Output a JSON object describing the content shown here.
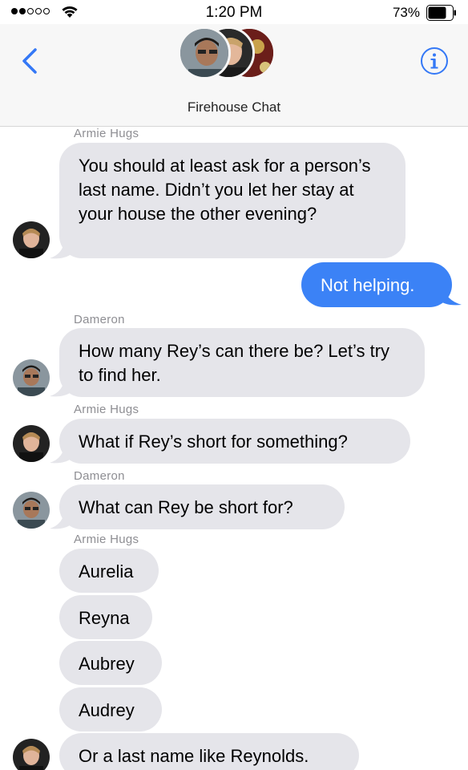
{
  "status_bar": {
    "time": "1:20 PM",
    "battery_percent": "73%"
  },
  "header": {
    "title": "Firehouse Chat"
  },
  "icons": {
    "back": "chevron-left-icon",
    "info": "info-icon",
    "wifi": "wifi-icon",
    "battery": "battery-icon"
  },
  "colors": {
    "accent": "#3b82f6",
    "received_bubble": "#e5e5ea",
    "sender_name": "#8e8e93"
  },
  "messages": [
    {
      "sender": "Armie Hugs",
      "text": "You should at least ask for a person’s last name. Didn’t you let her stay at your house the other evening?"
    },
    {
      "sender": "",
      "text": "Not helping."
    },
    {
      "sender": "Dameron",
      "text": "How many Rey’s can there be? Let’s try to find her."
    },
    {
      "sender": "Armie Hugs",
      "text": "What if Rey’s short for something?"
    },
    {
      "sender": "Dameron",
      "text": "What can Rey be short for?"
    },
    {
      "sender": "Armie Hugs",
      "text": "Aurelia"
    },
    {
      "sender": "",
      "text": "Reyna"
    },
    {
      "sender": "",
      "text": "Aubrey"
    },
    {
      "sender": "",
      "text": "Audrey"
    },
    {
      "sender": "",
      "text": "Or a last name like Reynolds."
    }
  ]
}
